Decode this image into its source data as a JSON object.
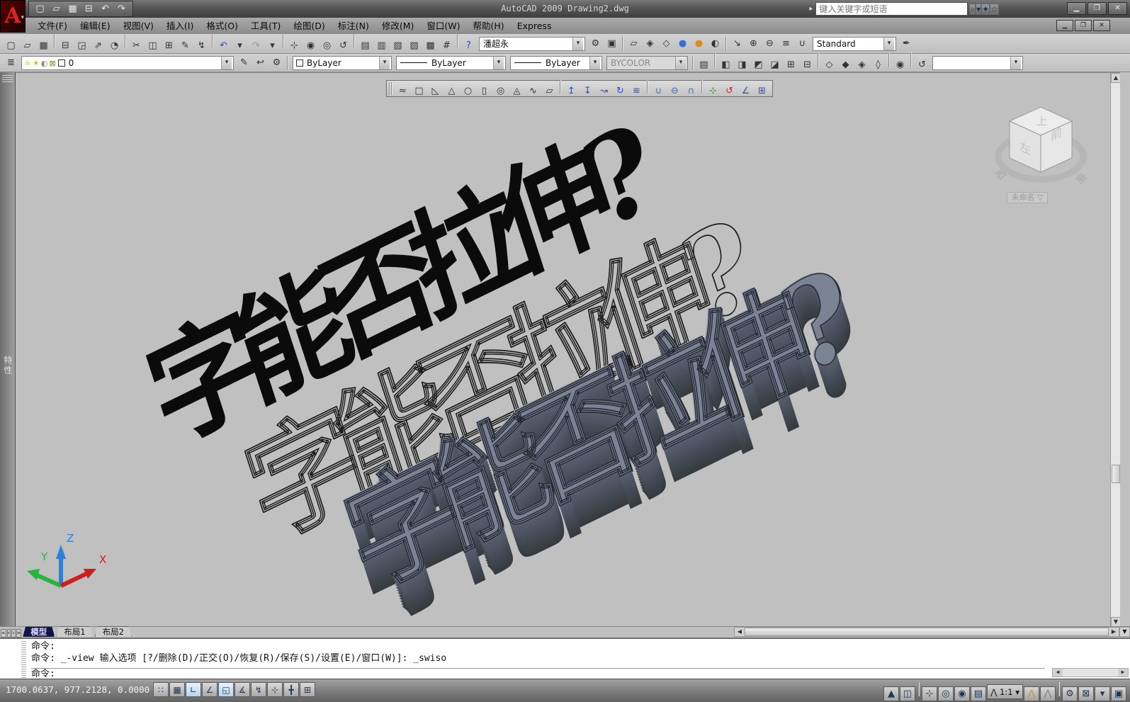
{
  "window": {
    "title": "AutoCAD 2009 Drawing2.dwg",
    "buttons": [
      {
        "name": "minimize-button",
        "glyph": "▁"
      },
      {
        "name": "restore-button",
        "glyph": "❐"
      },
      {
        "name": "close-button",
        "glyph": "✕"
      }
    ],
    "doc_buttons": [
      {
        "name": "doc-minimize-button",
        "glyph": "▁"
      },
      {
        "name": "doc-restore-button",
        "glyph": "❐"
      },
      {
        "name": "doc-close-button",
        "glyph": "✕"
      }
    ]
  },
  "logo": {
    "letter": "A"
  },
  "infocenter": {
    "arrow": "▸",
    "placeholder": "键入关键字或短语",
    "buttons": [
      {
        "name": "search-icon",
        "glyph": "⌕"
      },
      {
        "name": "search-dropdown-icon",
        "glyph": "▾"
      },
      {
        "name": "communication-center-icon",
        "glyph": "✦"
      },
      {
        "name": "favorites-star-icon",
        "glyph": "☆"
      }
    ]
  },
  "qat": [
    {
      "name": "qat-new-icon",
      "glyph": "▢"
    },
    {
      "name": "qat-open-icon",
      "glyph": "▱"
    },
    {
      "name": "qat-save-icon",
      "glyph": "▦"
    },
    {
      "name": "qat-plot-icon",
      "glyph": "⊟"
    },
    {
      "name": "qat-undo-icon",
      "glyph": "↶"
    },
    {
      "name": "qat-redo-icon",
      "glyph": "↷"
    }
  ],
  "menu": {
    "items": [
      {
        "name": "menu-file",
        "label": "文件(F)"
      },
      {
        "name": "menu-edit",
        "label": "编辑(E)"
      },
      {
        "name": "menu-view",
        "label": "视图(V)"
      },
      {
        "name": "menu-insert",
        "label": "插入(I)"
      },
      {
        "name": "menu-format",
        "label": "格式(O)"
      },
      {
        "name": "menu-tools",
        "label": "工具(T)"
      },
      {
        "name": "menu-draw",
        "label": "绘图(D)"
      },
      {
        "name": "menu-dimension",
        "label": "标注(N)"
      },
      {
        "name": "menu-modify",
        "label": "修改(M)"
      },
      {
        "name": "menu-window",
        "label": "窗口(W)"
      },
      {
        "name": "menu-help",
        "label": "帮助(H)"
      },
      {
        "name": "menu-express",
        "label": "Express"
      }
    ]
  },
  "standard_toolbar": [
    {
      "name": "new-icon",
      "glyph": "▢"
    },
    {
      "name": "open-icon",
      "glyph": "▱"
    },
    {
      "name": "save-icon",
      "glyph": "▦"
    },
    {
      "sep": true
    },
    {
      "name": "plot-icon",
      "glyph": "⊟"
    },
    {
      "name": "plot-preview-icon",
      "glyph": "◲"
    },
    {
      "name": "publish-icon",
      "glyph": "⇗"
    },
    {
      "name": "3d-dwf-icon",
      "glyph": "◔"
    },
    {
      "sep": true
    },
    {
      "name": "cut-icon",
      "glyph": "✂"
    },
    {
      "name": "copy-icon",
      "glyph": "◫"
    },
    {
      "name": "paste-icon",
      "glyph": "⊞"
    },
    {
      "name": "match-properties-icon",
      "glyph": "✎"
    },
    {
      "name": "block-editor-icon",
      "glyph": "↯"
    },
    {
      "sep": true
    },
    {
      "name": "undo-icon",
      "glyph": "↶",
      "color": "#2a50b8"
    },
    {
      "name": "undo-dropdown-icon",
      "glyph": "▾"
    },
    {
      "name": "redo-icon",
      "glyph": "↷",
      "color": "#9a9a9a"
    },
    {
      "name": "redo-dropdown-icon",
      "glyph": "▾"
    },
    {
      "sep": true
    },
    {
      "name": "pan-icon",
      "glyph": "⊹"
    },
    {
      "name": "zoom-realtime-icon",
      "glyph": "◉"
    },
    {
      "name": "zoom-window-icon",
      "glyph": "◎"
    },
    {
      "name": "zoom-previous-icon",
      "glyph": "↺"
    },
    {
      "sep": true
    },
    {
      "name": "properties-icon",
      "glyph": "▤"
    },
    {
      "name": "designcenter-icon",
      "glyph": "▥"
    },
    {
      "name": "tool-palettes-icon",
      "glyph": "▧"
    },
    {
      "name": "sheet-set-manager-icon",
      "glyph": "▨"
    },
    {
      "name": "markup-set-manager-icon",
      "glyph": "▩"
    },
    {
      "name": "quickcalc-icon",
      "glyph": "#"
    },
    {
      "sep": true
    },
    {
      "name": "help-icon",
      "glyph": "?",
      "color": "#1a4fd0"
    }
  ],
  "workspace": {
    "value": "潘超永",
    "icons": [
      {
        "name": "workspace-settings-gear-icon",
        "glyph": "⚙"
      },
      {
        "name": "save-workspace-icon",
        "glyph": "▣"
      }
    ]
  },
  "visual_styles": [
    {
      "name": "2d-wireframe-icon",
      "glyph": "▱"
    },
    {
      "name": "3d-wireframe-icon",
      "glyph": "◈"
    },
    {
      "name": "3d-hidden-icon",
      "glyph": "◇"
    },
    {
      "name": "realistic-icon",
      "glyph": "●",
      "color": "#2f6fd6"
    },
    {
      "name": "conceptual-icon",
      "glyph": "●",
      "color": "#e08a1a"
    },
    {
      "name": "manage-visual-styles-icon",
      "glyph": "◐"
    }
  ],
  "multileader": [
    {
      "name": "multileader-icon",
      "glyph": "↘"
    },
    {
      "name": "add-leader-icon",
      "glyph": "⊕"
    },
    {
      "name": "remove-leader-icon",
      "glyph": "⊖"
    },
    {
      "name": "align-leaders-icon",
      "glyph": "≡"
    },
    {
      "name": "collect-leaders-icon",
      "glyph": "∪"
    }
  ],
  "styles": {
    "value": "Standard",
    "manager_icon": "✒"
  },
  "layers": {
    "manager_icon": "≣",
    "current": "0",
    "dropdown_icons": [
      {
        "name": "layer-on-bulb-icon",
        "glyph": "☼",
        "color": "#c8a800"
      },
      {
        "name": "layer-freeze-sun-icon",
        "glyph": "☀",
        "color": "#c8a800"
      },
      {
        "name": "layer-vp-freeze-icon",
        "glyph": "◐",
        "color": "#8a8a8a"
      },
      {
        "name": "layer-lock-icon",
        "glyph": "⊠",
        "color": "#8a7a2a"
      }
    ],
    "tools": [
      {
        "name": "make-object-layer-current-icon",
        "glyph": "✎"
      },
      {
        "name": "layer-previous-icon",
        "glyph": "↩"
      },
      {
        "name": "layer-states-manager-icon",
        "glyph": "⚙"
      }
    ]
  },
  "properties_bar": {
    "color": "ByLayer",
    "linetype": "ByLayer",
    "lineweight": "ByLayer",
    "plot_style": "BYCOLOR"
  },
  "view_toolbar": [
    {
      "name": "named-views-icon",
      "glyph": "▤"
    },
    {
      "sep": true
    },
    {
      "name": "top-view-icon",
      "glyph": "◧"
    },
    {
      "name": "bottom-view-icon",
      "glyph": "◨"
    },
    {
      "name": "left-view-icon",
      "glyph": "◩"
    },
    {
      "name": "right-view-icon",
      "glyph": "◪"
    },
    {
      "name": "front-view-icon",
      "glyph": "⊞"
    },
    {
      "name": "back-view-icon",
      "glyph": "⊟"
    },
    {
      "sep": true
    },
    {
      "name": "sw-isometric-icon",
      "glyph": "◇"
    },
    {
      "name": "se-isometric-icon",
      "glyph": "◆"
    },
    {
      "name": "ne-isometric-icon",
      "glyph": "◈"
    },
    {
      "name": "nw-isometric-icon",
      "glyph": "◊"
    },
    {
      "sep": true
    },
    {
      "name": "create-camera-icon",
      "glyph": "◉"
    },
    {
      "sep": true
    },
    {
      "name": "view-previous-icon",
      "glyph": "↺"
    }
  ],
  "modeling_toolbar": [
    {
      "name": "polysolid-icon",
      "glyph": "≈"
    },
    {
      "name": "box-icon",
      "glyph": "□"
    },
    {
      "name": "wedge-icon",
      "glyph": "◺"
    },
    {
      "name": "cone-icon",
      "glyph": "△"
    },
    {
      "name": "sphere-icon",
      "glyph": "○"
    },
    {
      "name": "cylinder-icon",
      "glyph": "▯"
    },
    {
      "name": "torus-icon",
      "glyph": "◎"
    },
    {
      "name": "pyramid-icon",
      "glyph": "◬"
    },
    {
      "name": "helix-icon",
      "glyph": "∿"
    },
    {
      "name": "planar-surface-icon",
      "glyph": "▱"
    },
    {
      "sep": true
    },
    {
      "name": "extrude-icon",
      "glyph": "↥",
      "color": "#2a50b8"
    },
    {
      "name": "presspull-icon",
      "glyph": "↧",
      "color": "#2a50b8"
    },
    {
      "name": "sweep-icon",
      "glyph": "↝",
      "color": "#2a50b8"
    },
    {
      "name": "revolve-icon",
      "glyph": "↻",
      "color": "#2a50b8"
    },
    {
      "name": "loft-icon",
      "glyph": "≋",
      "color": "#2a50b8"
    },
    {
      "sep": true
    },
    {
      "name": "union-icon",
      "glyph": "∪",
      "color": "#3a6fb0"
    },
    {
      "name": "subtract-icon",
      "glyph": "⊖",
      "color": "#3a6fb0"
    },
    {
      "name": "intersect-icon",
      "glyph": "∩",
      "color": "#3a6fb0"
    },
    {
      "sep": true
    },
    {
      "name": "interference-check-icon",
      "glyph": "⊹",
      "color": "#2a8a3a"
    },
    {
      "name": "3d-move-icon",
      "glyph": "↺",
      "color": "#c03030"
    },
    {
      "name": "3d-align-icon",
      "glyph": "∠",
      "color": "#2a50b8"
    },
    {
      "name": "3d-array-icon",
      "glyph": "⊞",
      "color": "#2a50b8"
    }
  ],
  "viewcube": {
    "top": "上",
    "left": "左",
    "front": "前",
    "west": "西",
    "south": "南",
    "view_name": "未命名",
    "view_arrow": "▽"
  },
  "ucs": {
    "x": "X",
    "y": "Y",
    "z": "Z"
  },
  "palette": {
    "label": "特性"
  },
  "drawing": {
    "text": "字能否拉伸?"
  },
  "tabs": {
    "nav": [
      {
        "name": "tab-first-icon",
        "glyph": "«"
      },
      {
        "name": "tab-prev-icon",
        "glyph": "‹"
      },
      {
        "name": "tab-next-icon",
        "glyph": "›"
      },
      {
        "name": "tab-last-icon",
        "glyph": "»"
      }
    ],
    "items": [
      {
        "name": "tab-model",
        "label": "模型",
        "active": true
      },
      {
        "name": "tab-layout1",
        "label": "布局1"
      },
      {
        "name": "tab-layout2",
        "label": "布局2"
      }
    ]
  },
  "command": {
    "lines": [
      "命令:",
      "命令: _-view 输入选项 [?/删除(D)/正交(O)/恢复(R)/保存(S)/设置(E)/窗口(W)]: _swiso"
    ],
    "prompt": "命令:"
  },
  "statusbar": {
    "coords": "1700.0637, 977.2128, 0.0000",
    "toggles": [
      {
        "name": "snap-toggle",
        "glyph": "∷"
      },
      {
        "name": "grid-toggle",
        "glyph": "▦"
      },
      {
        "name": "ortho-toggle",
        "glyph": "∟",
        "active": true
      },
      {
        "name": "polar-toggle",
        "glyph": "∠"
      },
      {
        "name": "osnap-toggle",
        "glyph": "◱",
        "active": true
      },
      {
        "name": "otrack-toggle",
        "glyph": "∡"
      },
      {
        "name": "ducs-toggle",
        "glyph": "↯"
      },
      {
        "name": "dyn-toggle",
        "glyph": "⊹"
      },
      {
        "name": "lineweight-toggle",
        "glyph": "╋"
      },
      {
        "name": "quick-properties-toggle",
        "glyph": "⊞"
      }
    ],
    "right_group1": [
      {
        "name": "model-space-button",
        "glyph": "▲"
      },
      {
        "name": "layout-space-button",
        "glyph": "◫"
      },
      {
        "sep": true
      },
      {
        "name": "pan-tool-icon",
        "glyph": "⊹"
      },
      {
        "name": "zoom-tool-icon",
        "glyph": "◎"
      },
      {
        "name": "steering-wheel-icon",
        "glyph": "◉"
      },
      {
        "name": "show-motion-icon",
        "glyph": "▤"
      }
    ],
    "annotation_scale": "1:1",
    "annotation_icon": "⋀",
    "right_group2": [
      {
        "name": "annotation-visibility-icon",
        "glyph": "⋀",
        "color": "#b89a30"
      },
      {
        "name": "auto-annotation-scale-icon",
        "glyph": "⋀",
        "color": "#7d7d7d"
      },
      {
        "sep": true
      },
      {
        "name": "workspace-switch-gear-icon",
        "glyph": "⚙"
      },
      {
        "name": "toolbar-lock-icon",
        "glyph": "⊠"
      },
      {
        "name": "tray-menu-icon",
        "glyph": "▾"
      },
      {
        "name": "clean-screen-icon",
        "glyph": "▣"
      }
    ]
  }
}
